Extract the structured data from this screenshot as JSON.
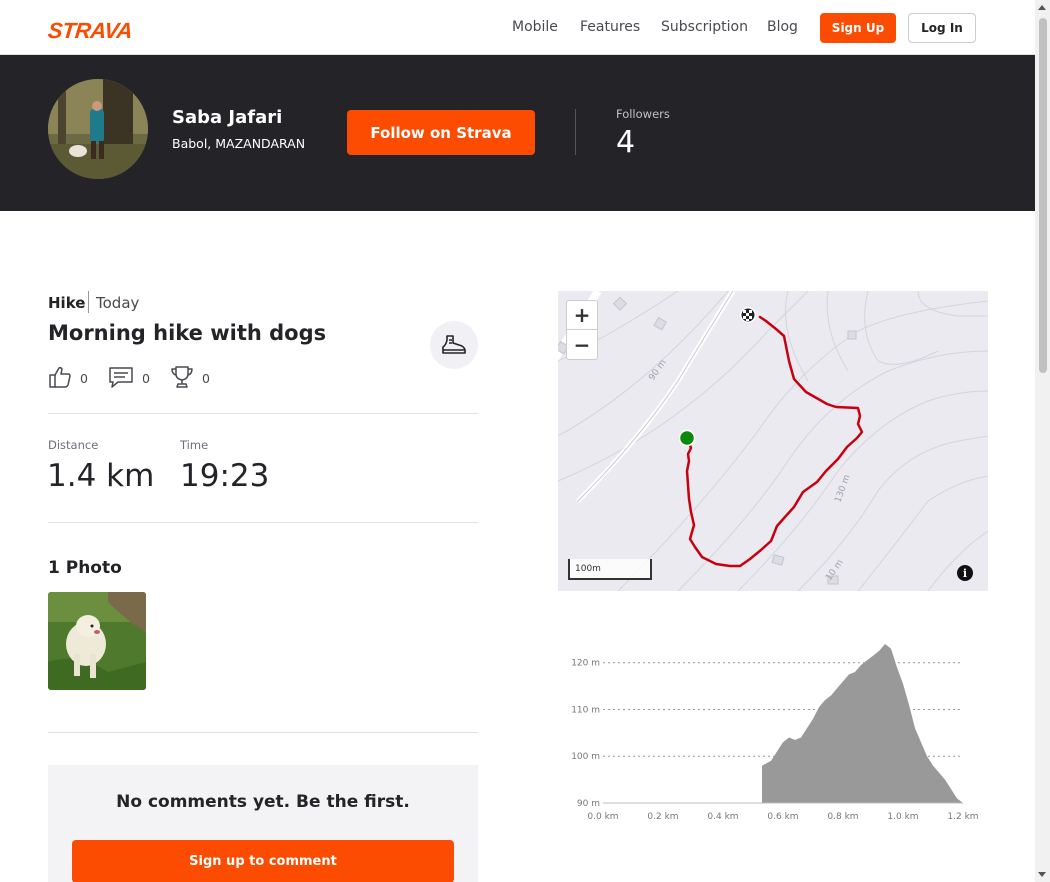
{
  "header": {
    "logo": "STRAVA",
    "nav": [
      "Mobile",
      "Features",
      "Subscription",
      "Blog"
    ],
    "signup_label": "Sign Up",
    "login_label": "Log In",
    "brand_color": "#fc4c02"
  },
  "athlete": {
    "name": "Saba Jafari",
    "location": "Babol, MAZANDARAN",
    "follow_label": "Follow on Strava",
    "followers_label": "Followers",
    "followers_count": "4"
  },
  "activity": {
    "sport": "Hike",
    "date": "Today",
    "title": "Morning hike with dogs",
    "sport_icon": "hiking-boot-icon",
    "kudos": "0",
    "comments": "0",
    "achievements": "0",
    "distance_label": "Distance",
    "distance_value": "1.4 km",
    "time_label": "Time",
    "time_value": "19:23",
    "photos_title": "1 Photo"
  },
  "comments": {
    "empty_text": "No comments yet. Be the first.",
    "signup_label": "Sign up to comment"
  },
  "map": {
    "zoom_in": "+",
    "zoom_out": "−",
    "scale_label": "100m",
    "contour_labels": [
      "90 m",
      "130 m",
      "10 m"
    ],
    "route_color": "#c8000f",
    "start_color": "#0a8a0a"
  },
  "chart_data": {
    "type": "area",
    "title": "",
    "xlabel": "",
    "ylabel": "",
    "xlim": [
      0,
      1.2
    ],
    "ylim": [
      90,
      124
    ],
    "x_ticks": [
      "0.0 km",
      "0.2 km",
      "0.4 km",
      "0.6 km",
      "0.8 km",
      "1.0 km",
      "1.2 km"
    ],
    "y_ticks": [
      "90 m",
      "100 m",
      "110 m",
      "120 m"
    ],
    "y_tick_values": [
      90,
      100,
      110,
      120
    ],
    "x": [
      0.53,
      0.53,
      0.56,
      0.58,
      0.6,
      0.62,
      0.64,
      0.66,
      0.68,
      0.7,
      0.72,
      0.74,
      0.76,
      0.78,
      0.8,
      0.82,
      0.84,
      0.86,
      0.88,
      0.9,
      0.92,
      0.94,
      0.96,
      0.98,
      1.0,
      1.02,
      1.04,
      1.06,
      1.08,
      1.1,
      1.12,
      1.14,
      1.16,
      1.18,
      1.2
    ],
    "series": [
      {
        "values": [
          90,
          98,
          99,
          101,
          103,
          104,
          103.5,
          104,
          106,
          108,
          110.5,
          112,
          113,
          114.5,
          116,
          117.5,
          118,
          119.5,
          120.5,
          121.5,
          122.5,
          124,
          123,
          119,
          115.5,
          111,
          106,
          103,
          100,
          98,
          96.5,
          95,
          93,
          91,
          90
        ]
      }
    ],
    "grid": "horizontal dashed",
    "fill_color": "#999999"
  }
}
